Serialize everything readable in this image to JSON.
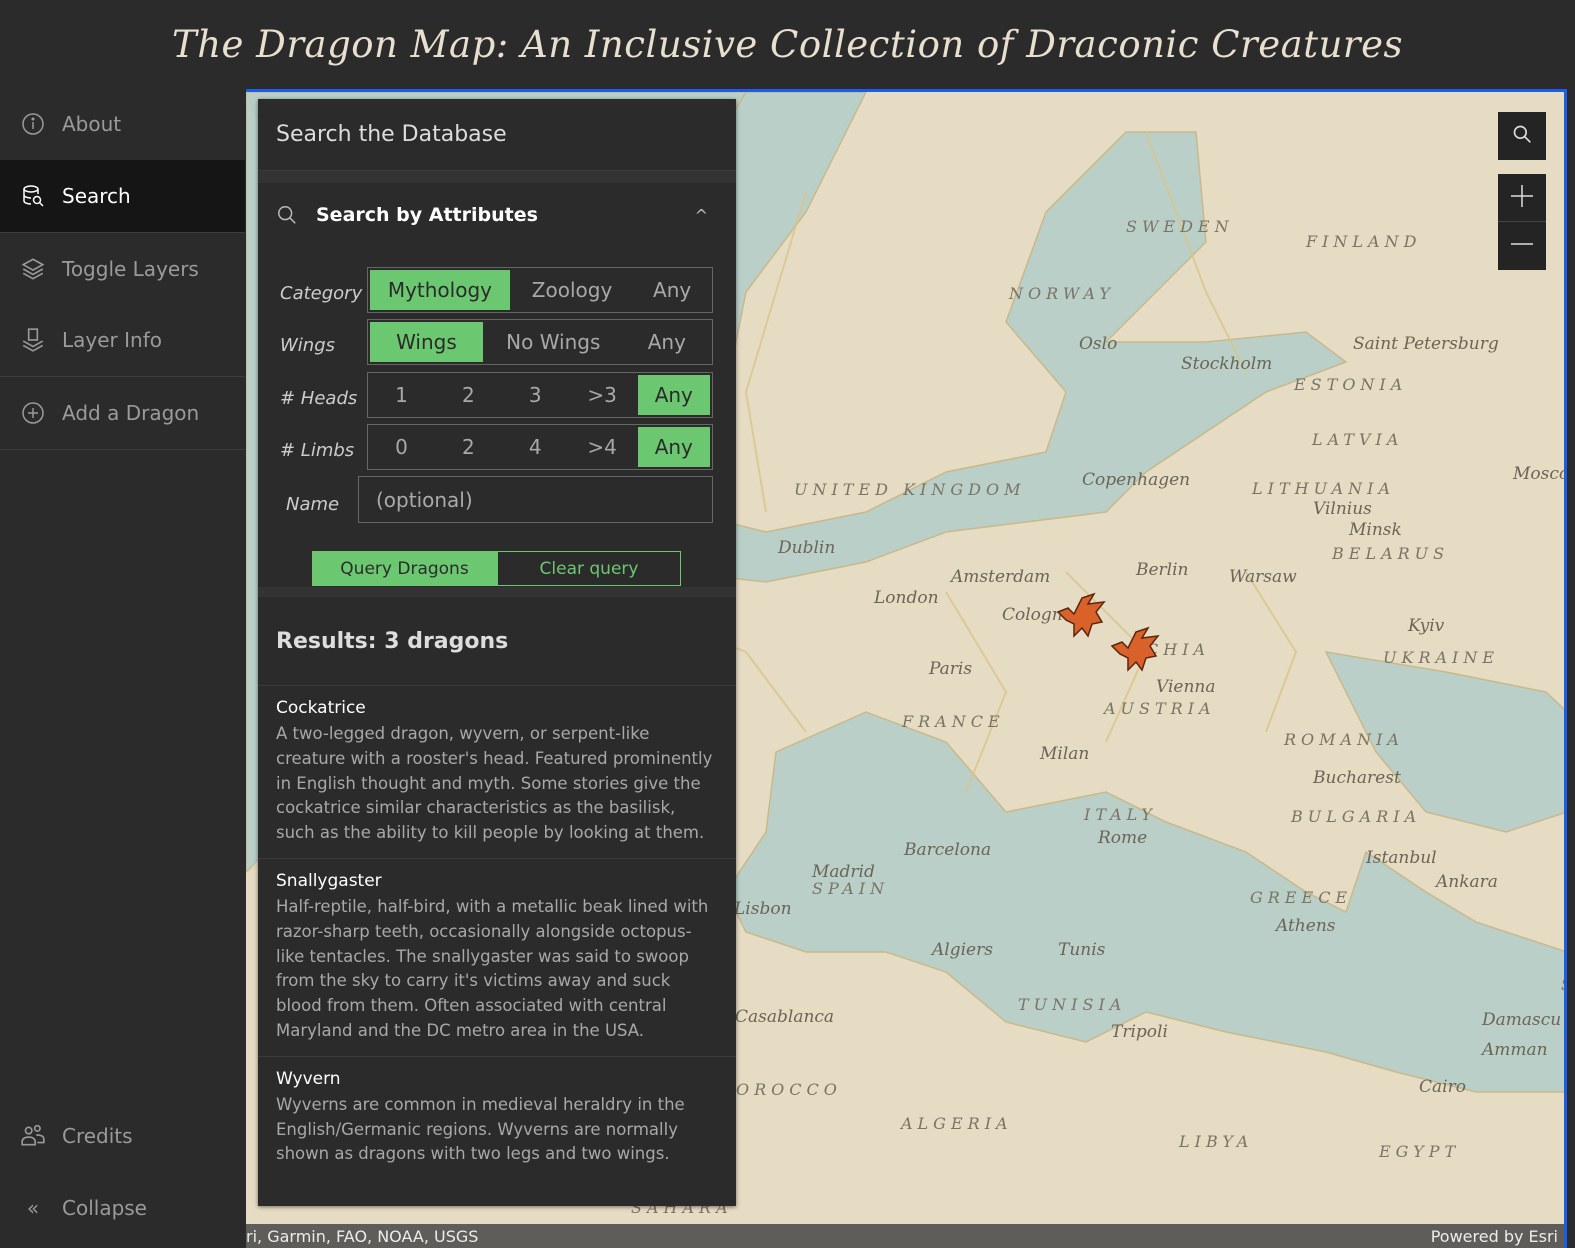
{
  "header": {
    "title": "The Dragon Map: An Inclusive Collection of Draconic Creatures"
  },
  "sidebar": {
    "items": [
      {
        "label": "About",
        "icon": "info-icon"
      },
      {
        "label": "Search",
        "icon": "database-search-icon",
        "active": true
      },
      {
        "label": "Toggle Layers",
        "icon": "layers-icon"
      },
      {
        "label": "Layer Info",
        "icon": "layer-info-icon"
      },
      {
        "label": "Add a Dragon",
        "icon": "plus-circle-icon"
      }
    ],
    "bottom": [
      {
        "label": "Credits",
        "icon": "users-icon"
      },
      {
        "label": "Collapse",
        "icon": "chevrons-left-icon"
      }
    ]
  },
  "panel": {
    "title": "Search the Database",
    "section": "Search by Attributes",
    "filters": [
      {
        "label": "Category",
        "options": [
          "Mythology",
          "Zoology",
          "Any"
        ],
        "selected": "Mythology"
      },
      {
        "label": "Wings",
        "options": [
          "Wings",
          "No Wings",
          "Any"
        ],
        "selected": "Wings"
      },
      {
        "label": "# Heads",
        "options": [
          "1",
          "2",
          "3",
          ">3",
          "Any"
        ],
        "selected": "Any"
      },
      {
        "label": "# Limbs",
        "options": [
          "0",
          "2",
          "4",
          ">4",
          "Any"
        ],
        "selected": "Any"
      }
    ],
    "name": {
      "label": "Name",
      "placeholder": "(optional)",
      "value": ""
    },
    "query_label": "Query Dragons",
    "clear_label": "Clear query",
    "results_title": "Results: 3 dragons",
    "results": [
      {
        "name": "Cockatrice",
        "description": "A two-legged dragon, wyvern, or serpent-like creature with a rooster's head. Featured prominently in English thought and myth. Some stories give the cockatrice similar characteristics as the basilisk, such as the ability to kill people by looking at them."
      },
      {
        "name": "Snallygaster",
        "description": "Half-reptile, half-bird, with a metallic beak lined with razor-sharp teeth, occasionally alongside octopus-like tentacles. The snallygaster was said to swoop from the sky to carry it's victims away and suck blood from them. Often associated with central Maryland and the DC metro area in the USA."
      },
      {
        "name": "Wyvern",
        "description": "Wyverns are common in medieval heraldry in the English/Germanic regions. Wyverns are normally shown as dragons with two legs and two wings."
      }
    ]
  },
  "map": {
    "accent": "#6cc870",
    "focus_color": "#1a5de8",
    "attribution": "ri, Garmin, FAO, NOAA, USGS",
    "powered_by": "Powered by Esri",
    "labels": [
      "SWEDEN",
      "FINLAND",
      "NORWAY",
      "Oslo",
      "Stockholm",
      "Saint Petersburg",
      "ESTONIA",
      "LATVIA",
      "Copenhagen",
      "LITHUANIA",
      "Vilnius",
      "Minsk",
      "BELARUS",
      "Mosco",
      "UNITED KINGDOM",
      "Dublin",
      "Amsterdam",
      "Berlin",
      "Warsaw",
      "London",
      "Cologne",
      "CHIA",
      "Kyiv",
      "UKRAINE",
      "Paris",
      "Vienna",
      "AUSTRIA",
      "FRANCE",
      "Milan",
      "ROMANIA",
      "Bucharest",
      "BULGARIA",
      "ITALY",
      "Rome",
      "Barcelona",
      "Madrid",
      "SPAIN",
      "Istanbul",
      "Ankara",
      "Lisbon",
      "GREECE",
      "Athens",
      "Algiers",
      "Tunis",
      "TUNISIA",
      "Tripoli",
      "Casablanca",
      "OROCCO",
      "ALGERIA",
      "LIBYA",
      "Cairo",
      "EGYPT",
      "Damascu",
      "Amman",
      "SY",
      "SAHARA"
    ]
  }
}
